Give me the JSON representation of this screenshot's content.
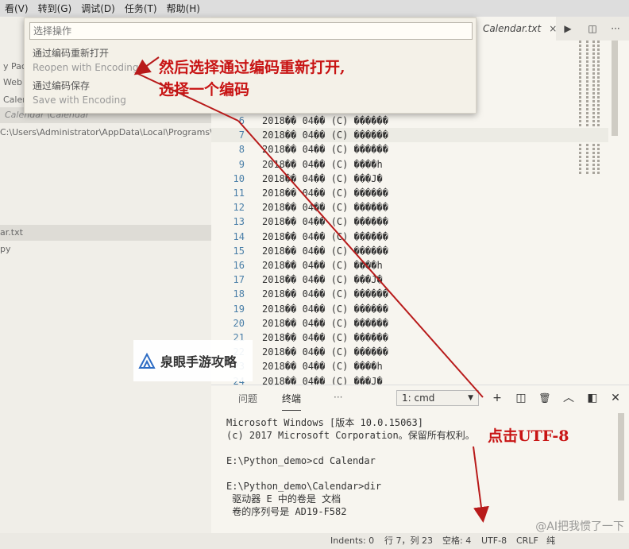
{
  "menubar": {
    "items": [
      "看(V)",
      "转到(G)",
      "调试(D)",
      "任务(T)",
      "帮助(H)"
    ]
  },
  "sidebar": {
    "rows": [
      {
        "text": "y  Pac"
      },
      {
        "text": "Web"
      },
      {
        "text": "Caler"
      },
      {
        "text": "Calendar \\Calendar"
      },
      {
        "text": "C:\\Users\\Administrator\\AppData\\Local\\Programs\\Pyt..."
      },
      {
        "text": "ar.txt"
      },
      {
        "text": "py"
      }
    ]
  },
  "tab": {
    "label": "Calendar.txt",
    "close": "×"
  },
  "toolbar_icons": [
    "▶",
    "◫",
    "···"
  ],
  "palette": {
    "placeholder": "选择操作",
    "options": [
      {
        "label": "通过编码重新打开",
        "dim": false
      },
      {
        "label": "Reopen with Encoding",
        "dim": true
      },
      {
        "label": "通过编码保存",
        "dim": false
      },
      {
        "label": "Save with Encoding",
        "dim": true
      }
    ]
  },
  "editor_lines": [
    {
      "n": "6",
      "text": "2018�� 04�� (C) ������"
    },
    {
      "n": "7",
      "text": "2018�� 04�� (C) ������"
    },
    {
      "n": "8",
      "text": "2018�� 04�� (C) ������"
    },
    {
      "n": "9",
      "text": "2018�� 04�� (C) ����h"
    },
    {
      "n": "10",
      "text": "2018�� 04�� (C) ���J�"
    },
    {
      "n": "11",
      "text": "2018�� 04�� (C) ������"
    },
    {
      "n": "12",
      "text": "2018�� 04�� (C) ������"
    },
    {
      "n": "13",
      "text": "2018�� 04�� (C) ������"
    },
    {
      "n": "14",
      "text": "2018�� 04�� (C) ������"
    },
    {
      "n": "15",
      "text": "2018�� 04�� (C) ������"
    },
    {
      "n": "16",
      "text": "2018�� 04�� (C) ����h"
    },
    {
      "n": "17",
      "text": "2018�� 04�� (C) ���J�"
    },
    {
      "n": "18",
      "text": "2018�� 04�� (C) ������"
    },
    {
      "n": "19",
      "text": "2018�� 04�� (C) ������"
    },
    {
      "n": "20",
      "text": "2018�� 04�� (C) ������"
    },
    {
      "n": "21",
      "text": "2018�� 04�� (C) ������"
    },
    {
      "n": "22",
      "text": "2018�� 04�� (C) ������"
    },
    {
      "n": "23",
      "text": "2018�� 04�� (C) ����h"
    },
    {
      "n": "24",
      "text": "2018�� 04�� (C) ���J�"
    }
  ],
  "annotations": {
    "top_line1": "然后选择通过编码重新打开,",
    "top_line2": "选择一个编码",
    "bottom": "点击UTF-8",
    "color": "#c81414"
  },
  "watermark": {
    "text": "泉眼手游攻略"
  },
  "panel": {
    "tabs": [
      "问题",
      "终端",
      "···"
    ],
    "terminal_select": "1: cmd",
    "icons": [
      "+",
      "◫",
      "🗑",
      "︿",
      "◧",
      "✕"
    ],
    "lines": [
      "Microsoft Windows [版本 10.0.15063]",
      "(c) 2017 Microsoft Corporation。保留所有权利。",
      "",
      "E:\\Python_demo>cd Calendar",
      "",
      "E:\\Python_demo\\Calendar>dir",
      " 驱动器 E 中的卷是 文档",
      " 卷的序列号是 AD19-F582"
    ]
  },
  "statusbar": {
    "indents": "Indents: 0",
    "position": "行 7，列 23",
    "spaces": "空格: 4",
    "encoding": "UTF-8",
    "eol": "CRLF",
    "extra": "纯"
  },
  "credit": "@AI把我惯了一下"
}
